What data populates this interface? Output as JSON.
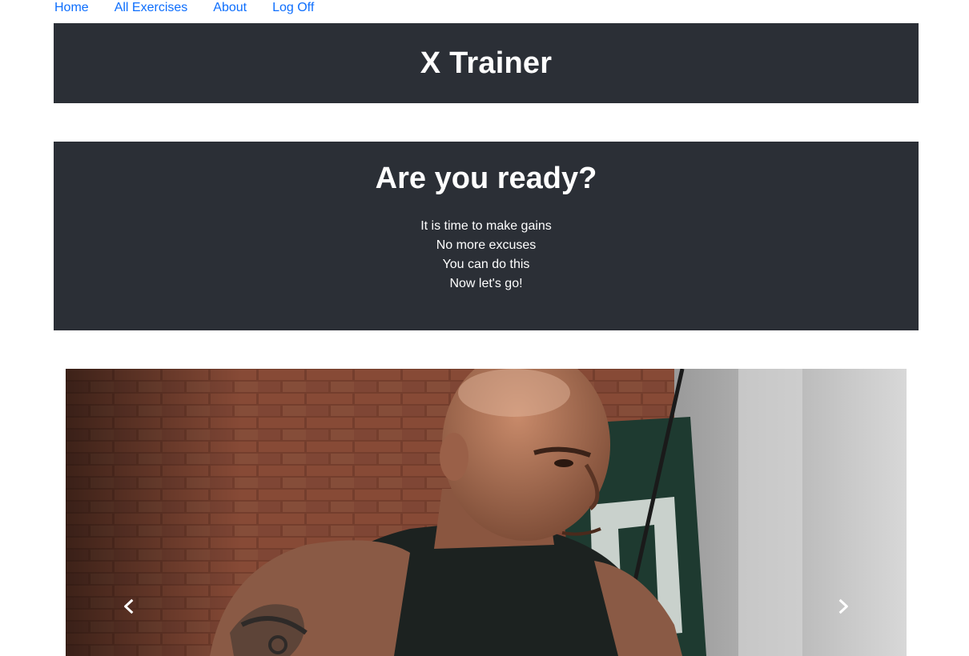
{
  "nav": {
    "items": [
      {
        "label": "Home"
      },
      {
        "label": "All Exercises"
      },
      {
        "label": "About"
      },
      {
        "label": "Log Off"
      }
    ]
  },
  "header": {
    "title": "X Trainer"
  },
  "hero": {
    "heading": "Are you ready?",
    "lines": [
      "It is time to make gains",
      "No more excuses",
      "You can do this",
      "Now let's go!"
    ]
  },
  "carousel": {
    "prev_icon": "chevron-left-icon",
    "next_icon": "chevron-right-icon"
  },
  "colors": {
    "link": "#0d6efd",
    "panel": "#2b2f36",
    "text_on_panel": "#ffffff"
  }
}
